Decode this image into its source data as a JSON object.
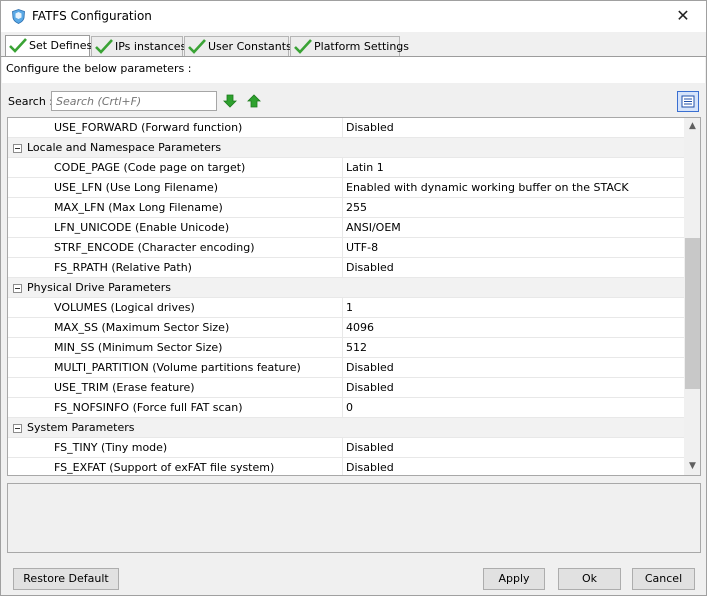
{
  "window": {
    "title": "FATFS Configuration"
  },
  "tabs": [
    {
      "label": "Set Defines",
      "active": true
    },
    {
      "label": "IPs instances",
      "active": false
    },
    {
      "label": "User Constants",
      "active": false
    },
    {
      "label": "Platform Settings",
      "active": false
    }
  ],
  "header": {
    "instruction": "Configure the below parameters :"
  },
  "search": {
    "label": "Search :",
    "placeholder": "Search (Crtl+F)"
  },
  "rows": [
    {
      "type": "param",
      "name": "USE_FORWARD (Forward function)",
      "value": "Disabled"
    },
    {
      "type": "group",
      "name": "Locale and Namespace Parameters"
    },
    {
      "type": "param",
      "name": "CODE_PAGE (Code page on target)",
      "value": "Latin 1"
    },
    {
      "type": "param",
      "name": "USE_LFN (Use Long Filename)",
      "value": "Enabled with dynamic working buffer on the STACK"
    },
    {
      "type": "param",
      "name": "MAX_LFN (Max Long Filename)",
      "value": "255"
    },
    {
      "type": "param",
      "name": "LFN_UNICODE (Enable Unicode)",
      "value": "ANSI/OEM"
    },
    {
      "type": "param",
      "name": "STRF_ENCODE (Character encoding)",
      "value": "UTF-8"
    },
    {
      "type": "param",
      "name": "FS_RPATH (Relative Path)",
      "value": "Disabled"
    },
    {
      "type": "group",
      "name": "Physical Drive Parameters"
    },
    {
      "type": "param",
      "name": "VOLUMES (Logical drives)",
      "value": "1"
    },
    {
      "type": "param",
      "name": "MAX_SS (Maximum Sector Size)",
      "value": "4096"
    },
    {
      "type": "param",
      "name": "MIN_SS (Minimum Sector Size)",
      "value": "512"
    },
    {
      "type": "param",
      "name": "MULTI_PARTITION (Volume partitions feature)",
      "value": "Disabled"
    },
    {
      "type": "param",
      "name": "USE_TRIM (Erase feature)",
      "value": "Disabled"
    },
    {
      "type": "param",
      "name": "FS_NOFSINFO (Force full FAT scan)",
      "value": "0"
    },
    {
      "type": "group",
      "name": "System Parameters"
    },
    {
      "type": "param",
      "name": "FS_TINY (Tiny mode)",
      "value": "Disabled"
    },
    {
      "type": "param",
      "name": "FS_EXFAT (Support of exFAT file system)",
      "value": "Disabled"
    }
  ],
  "buttons": {
    "restore_default": "Restore Default",
    "apply": "Apply",
    "ok": "Ok",
    "cancel": "Cancel"
  },
  "icons": {
    "window": "shield-icon",
    "tab": "checkmark-icon",
    "search_next": "arrow-down-icon",
    "search_prev": "arrow-up-icon",
    "view": "list-view-icon",
    "close": "close-icon"
  },
  "colors": {
    "tab_check": "#3aa335",
    "search_arrow": "#2ea12e",
    "view_button": "#3a6fd1"
  }
}
